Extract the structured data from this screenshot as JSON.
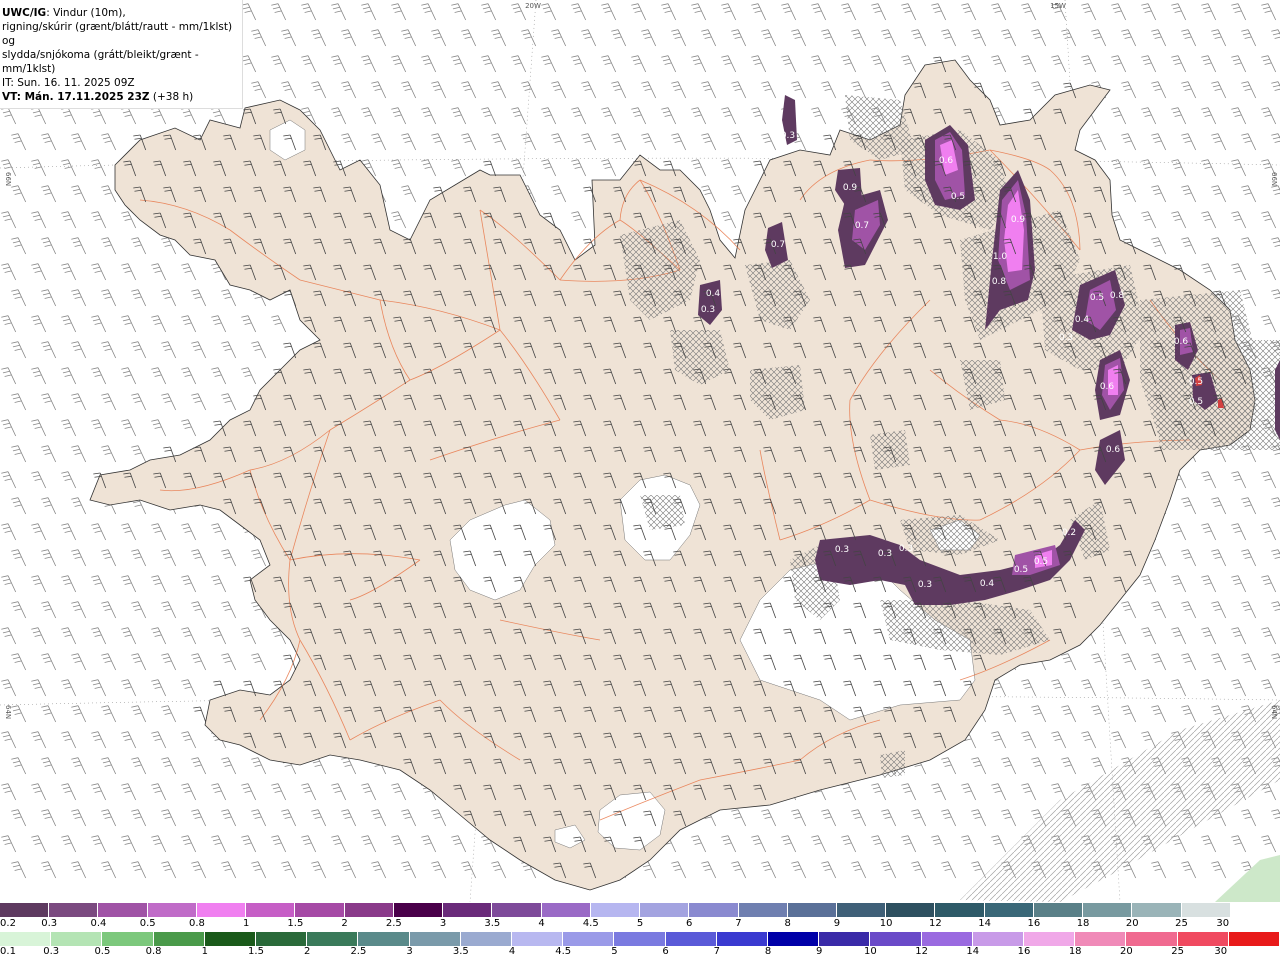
{
  "header": {
    "model": "UWC/IG",
    "line1": ": Vindur (10m),",
    "line2": "rigning/skúrir (grænt/blátt/rautt - mm/1klst) og",
    "line3": "slydda/snjókoma (grátt/bleikt/grænt - mm/1klst)",
    "it": "IT: Sun. 16. 11. 2025 09Z",
    "vt": "VT: Mán. 17.11.2025 23Z",
    "lead": " (+38 h)"
  },
  "grid_labels": {
    "top_20w": "20W",
    "top_15w": "15W",
    "left_66n": "66N",
    "right_66n": "66N",
    "left_64n": "64N",
    "right_64n": "64N"
  },
  "colors": {
    "land": "#efe3d6",
    "roads": "#e8784a",
    "snow_dark": "#5e3a60",
    "snow_mid": "#9b4aa8",
    "snow_light": "#f07ff0",
    "legend_top": [
      "#5e3a60",
      "#7b4a80",
      "#a053a6",
      "#c06bc8",
      "#f07ff0",
      "#c65ec6",
      "#a64aa6",
      "#8a3a8a",
      "#4a004a",
      "#6a2a7a",
      "#7e4a9a",
      "#9a6ac6",
      "#b6b6f0",
      "#a3a3e0",
      "#8a8ad0",
      "#6f7fb0",
      "#5a7098",
      "#3f6078",
      "#2e5060",
      "#2e5a68",
      "#3a6878",
      "#5a8088",
      "#789aa0",
      "#9ab4b8",
      "#d8e0e0",
      "#ffffff"
    ],
    "legend_bottom": [
      "#d8f4d8",
      "#b4e4b4",
      "#7cc87c",
      "#4a9a4a",
      "#1a5a1a",
      "#2a6a3a",
      "#3a7a5a",
      "#5a8a8a",
      "#7a9aaa",
      "#9aaad0",
      "#b8b8f0",
      "#9a9ae8",
      "#7a7ae0",
      "#5a5ad8",
      "#3a3ad0",
      "#0000a8",
      "#3a2aa8",
      "#6a4ac8",
      "#9a6ae0",
      "#c89ae8",
      "#f0a8e8",
      "#f08ab8",
      "#f06a90",
      "#f04a60",
      "#e81a1a"
    ]
  },
  "legend": {
    "top_labels": [
      "0.2",
      "0.3",
      "0.4",
      "0.5",
      "0.8",
      "1",
      "1.5",
      "2",
      "2.5",
      "3",
      "3.5",
      "4",
      "4.5",
      "5",
      "6",
      "7",
      "8",
      "9",
      "10",
      "12",
      "14",
      "16",
      "18",
      "20",
      "25",
      "30"
    ],
    "bottom_labels": [
      "0.1",
      "0.3",
      "0.5",
      "0.8",
      "1",
      "1.5",
      "2",
      "2.5",
      "3",
      "3.5",
      "4",
      "4.5",
      "5",
      "6",
      "7",
      "8",
      "9",
      "10",
      "12",
      "14",
      "16",
      "18",
      "20",
      "25",
      "30"
    ]
  },
  "precip_labels": [
    "0.3",
    "0.9",
    "0.7",
    "0.7",
    "0.6",
    "0.5",
    "0.9",
    "1.0",
    "0.8",
    "0.4",
    "0.3",
    "0.5",
    "0.8",
    "0.4",
    "0.3",
    "0.6",
    "0.6",
    "0.5",
    "0.5",
    "0.6",
    "0.2",
    "0.3",
    "0.3",
    "0.3",
    "0.3",
    "0.4",
    "0.5",
    "0.5"
  ]
}
